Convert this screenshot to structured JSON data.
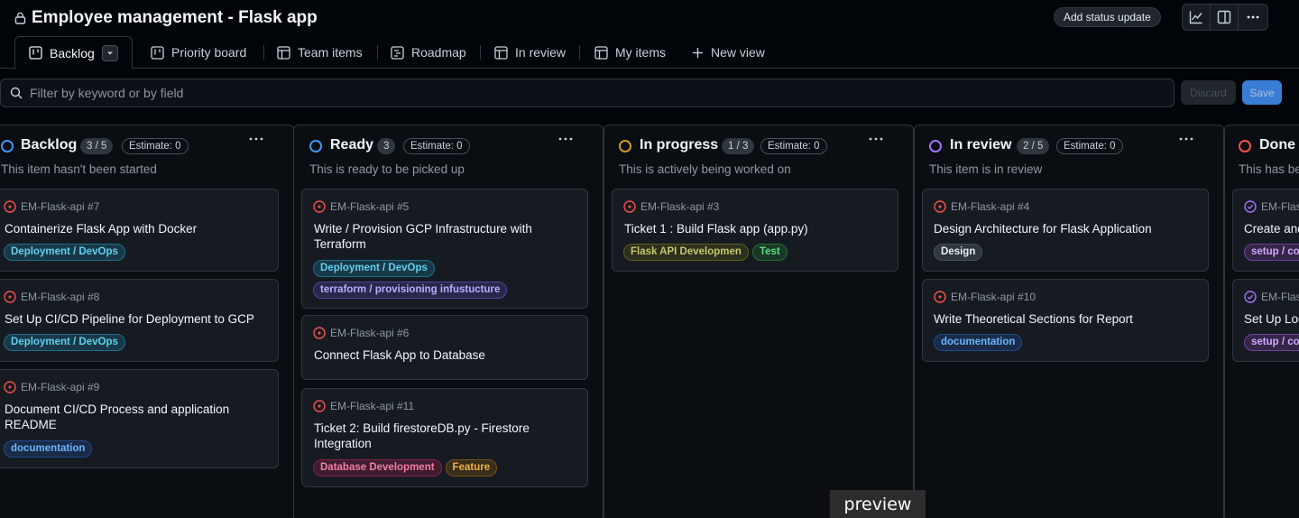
{
  "header": {
    "title": "Employee management - Flask app",
    "status_update_label": "Add status update"
  },
  "tabs": [
    {
      "label": "Backlog",
      "icon": "board-icon",
      "active": true
    },
    {
      "label": "Priority board",
      "icon": "board-icon"
    },
    {
      "label": "Team items",
      "icon": "table-icon"
    },
    {
      "label": "Roadmap",
      "icon": "roadmap-icon"
    },
    {
      "label": "In review",
      "icon": "table-icon"
    },
    {
      "label": "My items",
      "icon": "table-icon"
    },
    {
      "label": "New view",
      "icon": "plus-icon"
    }
  ],
  "filter": {
    "placeholder": "Filter by keyword or by field",
    "discard_label": "Discard",
    "save_label": "Save"
  },
  "columns": [
    {
      "name": "Backlog",
      "count": "3 / 5",
      "estimate": "Estimate: 0",
      "description": "This item hasn't been started",
      "color": "#4493f8",
      "cards": [
        {
          "ref": "EM-Flask-api #7",
          "title": "Containerize Flask App with Docker",
          "labels": [
            {
              "text": "Deployment / DevOps",
              "style": "cyan"
            }
          ]
        },
        {
          "ref": "EM-Flask-api #8",
          "title": "Set Up CI/CD Pipeline for Deployment to GCP",
          "labels": [
            {
              "text": "Deployment / DevOps",
              "style": "cyan"
            }
          ]
        },
        {
          "ref": "EM-Flask-api #9",
          "title": "Document CI/CD Process and application README",
          "labels": [
            {
              "text": "documentation",
              "style": "blue"
            }
          ]
        }
      ]
    },
    {
      "name": "Ready",
      "count": "3",
      "estimate": "Estimate: 0",
      "description": "This is ready to be picked up",
      "color": "#4493f8",
      "cards": [
        {
          "ref": "EM-Flask-api #5",
          "title": "Write / Provision GCP Infrastructure with Terraform",
          "labels": [
            {
              "text": "Deployment / DevOps",
              "style": "cyan"
            },
            {
              "text": "terraform / provisioning infustucture",
              "style": "purple"
            }
          ]
        },
        {
          "ref": "EM-Flask-api #6",
          "title": "Connect Flask App to Database",
          "labels": []
        },
        {
          "ref": "EM-Flask-api #11",
          "title": "Ticket 2: Build firestoreDB.py - Firestore Integration",
          "labels": [
            {
              "text": "Database Development",
              "style": "pink"
            },
            {
              "text": "Feature",
              "style": "orange"
            }
          ]
        }
      ]
    },
    {
      "name": "In progress",
      "count": "1 / 3",
      "estimate": "Estimate: 0",
      "description": "This is actively being worked on",
      "color": "#d29922",
      "cards": [
        {
          "ref": "EM-Flask-api #3",
          "title": "Ticket 1 : Build Flask app (app.py)",
          "labels": [
            {
              "text": "Flask API Developmen",
              "style": "olive"
            },
            {
              "text": "Test",
              "style": "green"
            }
          ]
        }
      ]
    },
    {
      "name": "In review",
      "count": "2 / 5",
      "estimate": "Estimate: 0",
      "description": "This item is in review",
      "color": "#a371f7",
      "cards": [
        {
          "ref": "EM-Flask-api #4",
          "title": "Design Architecture for Flask Application",
          "labels": [
            {
              "text": "Design",
              "style": "gray"
            }
          ]
        },
        {
          "ref": "EM-Flask-api #10",
          "title": "Write Theoretical Sections for Report",
          "labels": [
            {
              "text": "documentation",
              "style": "blue"
            }
          ]
        }
      ]
    },
    {
      "name": "Done",
      "count": "",
      "estimate": "",
      "description": "This has been completed",
      "color": "#f85149",
      "cards": [
        {
          "ref": "EM-Flask-api",
          "title": "Create and",
          "labels": [
            {
              "text": "setup / config",
              "style": "mauve"
            }
          ],
          "done": true
        },
        {
          "ref": "EM-Flask-api",
          "title": "Set Up Logging",
          "labels": [
            {
              "text": "setup / config",
              "style": "mauve"
            }
          ],
          "done": true
        }
      ]
    }
  ],
  "overlay": {
    "preview_label": "preview"
  },
  "colors": {
    "background": "#010409",
    "border": "#30363d",
    "accent": "#4493f8",
    "open_issue": "#f85149"
  }
}
